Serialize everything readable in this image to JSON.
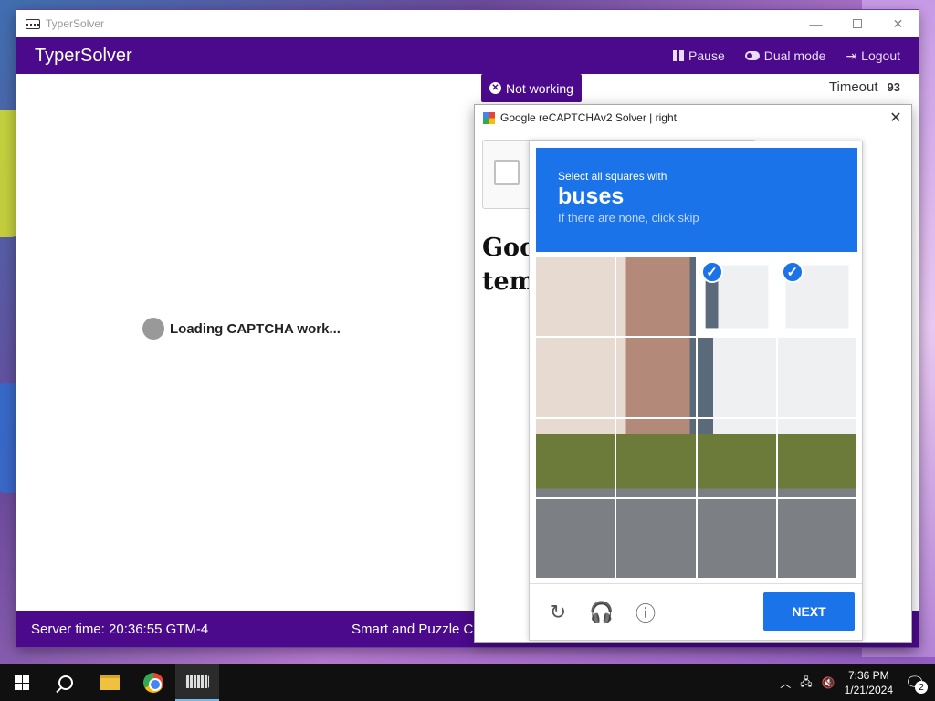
{
  "window": {
    "title": "TyperSolver",
    "controls": [
      "—",
      "☐",
      "✕"
    ]
  },
  "header": {
    "app_name": "TyperSolver",
    "actions": [
      {
        "label": "Pause",
        "icon": "pause-icon"
      },
      {
        "label": "Dual mode",
        "icon": "toggle-icon"
      },
      {
        "label": "Logout",
        "icon": "logout-icon"
      }
    ]
  },
  "status": {
    "label": "Not working",
    "icon": "x-circle-icon"
  },
  "timeout": {
    "label": "Timeout",
    "value": "93"
  },
  "main": {
    "loading_text": "Loading CAPTCHA work..."
  },
  "footer": {
    "server_time": "Server time: 20:36:55 GTM-4",
    "right_text": "Smart and Puzzle C"
  },
  "solver": {
    "title": "Google reCAPTCHAv2 Solver | right",
    "background_heading": "Goo\ntem"
  },
  "challenge": {
    "subtitle": "Select all squares with",
    "target": "buses",
    "hint": "If there are none, click skip",
    "selected_tiles": [
      2,
      3
    ],
    "next_label": "NEXT",
    "footer_icons": [
      "reload-icon",
      "audio-icon",
      "info-icon"
    ]
  },
  "taskbar": {
    "time": "7:36 PM",
    "date": "1/21/2024",
    "notification_count": "2"
  },
  "colors": {
    "header_purple": "#4b0a8c",
    "captcha_blue": "#1a73e8"
  }
}
